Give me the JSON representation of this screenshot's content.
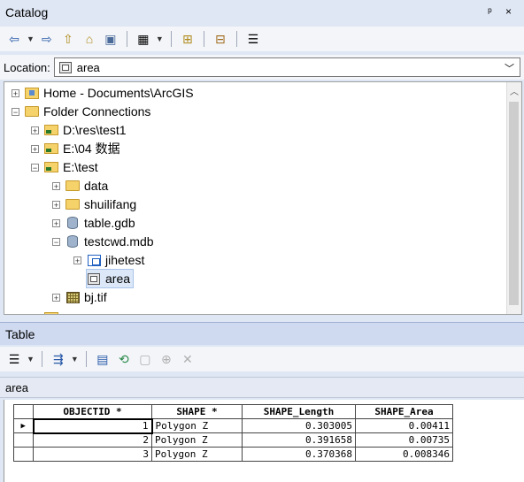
{
  "catalog": {
    "title": "Catalog",
    "controls": "p ×"
  },
  "location": {
    "label": "Location:",
    "value": "area"
  },
  "tree": {
    "items": [
      {
        "label": "Home - Documents\\ArcGIS",
        "expander": "+"
      },
      {
        "label": "Folder Connections",
        "expander": "−"
      },
      {
        "label": "D:\\res\\test1",
        "expander": "+"
      },
      {
        "label": "E:\\04 数据",
        "expander": "+"
      },
      {
        "label": "E:\\test",
        "expander": "−"
      },
      {
        "label": "data",
        "expander": "+"
      },
      {
        "label": "shuilifang",
        "expander": "+"
      },
      {
        "label": "table.gdb",
        "expander": "+"
      },
      {
        "label": "testcwd.mdb",
        "expander": "−"
      },
      {
        "label": "jihetest",
        "expander": "+"
      },
      {
        "label": "area",
        "expander": ""
      },
      {
        "label": "bj.tif",
        "expander": "+"
      }
    ]
  },
  "table_panel": {
    "title": "Table",
    "caption": "area",
    "columns": [
      "OBJECTID *",
      "SHAPE *",
      "SHAPE_Length",
      "SHAPE_Area"
    ],
    "rows": [
      {
        "OBJECTID": "1",
        "SHAPE": "Polygon Z",
        "SHAPE_Length": "0.303005",
        "SHAPE_Area": "0.00411"
      },
      {
        "OBJECTID": "2",
        "SHAPE": "Polygon Z",
        "SHAPE_Length": "0.391658",
        "SHAPE_Area": "0.00735"
      },
      {
        "OBJECTID": "3",
        "SHAPE": "Polygon Z",
        "SHAPE_Length": "0.370368",
        "SHAPE_Area": "0.008346"
      }
    ],
    "current_row_marker": "▶"
  }
}
